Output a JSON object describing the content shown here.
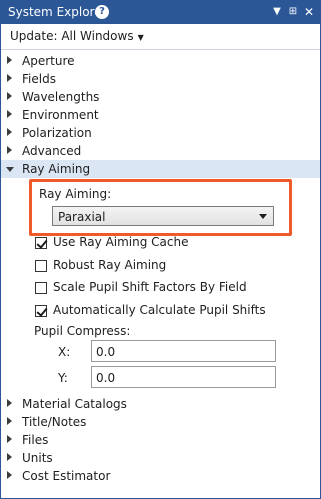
{
  "window": {
    "title": "System Explorer",
    "colors": {
      "titlebar": "#2b5797",
      "highlight": "#f05a28",
      "selected_row": "#dbe6f4"
    }
  },
  "toolbar": {
    "update_label": "Update: All Windows"
  },
  "tree": {
    "top_items": [
      {
        "label": "Aperture"
      },
      {
        "label": "Fields"
      },
      {
        "label": "Wavelengths"
      },
      {
        "label": "Environment"
      },
      {
        "label": "Polarization"
      },
      {
        "label": "Advanced"
      },
      {
        "label": "Ray Aiming"
      }
    ],
    "bottom_items": [
      {
        "label": "Material Catalogs"
      },
      {
        "label": "Title/Notes"
      },
      {
        "label": "Files"
      },
      {
        "label": "Units"
      },
      {
        "label": "Cost Estimator"
      }
    ]
  },
  "ray_aiming": {
    "section_label": "Ray Aiming:",
    "selected": "Paraxial",
    "checkboxes": [
      {
        "label": "Use Ray Aiming Cache",
        "checked": true
      },
      {
        "label": "Robust Ray Aiming",
        "checked": false
      },
      {
        "label": "Scale Pupil Shift Factors By Field",
        "checked": false
      },
      {
        "label": "Automatically Calculate Pupil Shifts",
        "checked": true
      }
    ],
    "pupil_compress_label": "Pupil Compress:",
    "x_label": "X:",
    "x_value": "0.0",
    "y_label": "Y:",
    "y_value": "0.0"
  }
}
